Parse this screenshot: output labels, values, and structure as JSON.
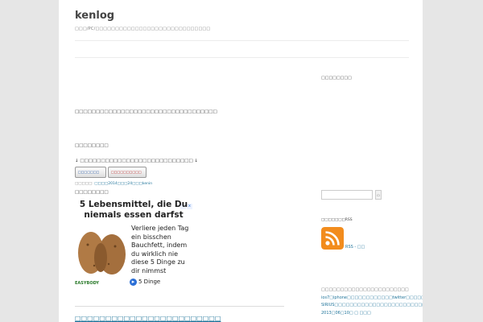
{
  "site": {
    "title": "kenlog",
    "description": "□□□/PC/□□□□□□□□□□□□□□□□□□□□□□□□□□□□□"
  },
  "post": {
    "para1": "□□□□□□□□□□□□□□□□□□□□□□□□□□□□□□□□□□",
    "para2": "□□□□□□□□",
    "ranking_note": "↓ □□□□□□□□□□□□□□□□□□□□□□□□□□□ ↓",
    "banners": [
      "□□□□□□□",
      "□□□□□□□□□□"
    ],
    "meta_prefix": "□□□□□: ",
    "meta_date": "□□□□2014□□□24□",
    "meta_author": "□□kenin",
    "para3": "□□□□□□□□"
  },
  "ad": {
    "badge": [
      "i",
      "x"
    ],
    "headline": "5 Lebensmittel, die Du niemals essen darfst",
    "body": "Verliere jeden Tag ein bisschen Bauchfett, indem du wirklich nie diese 5 Dinge zu dir nimmst",
    "logo": "EASYBODY",
    "cta": "5 Dinge",
    "cta_icon": "▸"
  },
  "next_post": {
    "title": "□□□□□□□□□□□□□□□□□□□□□□□□"
  },
  "sidebar": {
    "heading": "□□□□□□□□",
    "search_placeholder": "",
    "search_button": "□",
    "rss_heading": "□□□□□□□RSS",
    "rss_link": "RSS - □□",
    "recent_heading": "□□□□□□□□□□□□□□□□□□□□□□□",
    "recent": [
      "ios7□iphone□□□□□□□□□□□□twitter□□□□□□□□□□",
      "SIRIUS□□□□□□□□□□□□□□□□□□□□□□□□□□□□",
      "2013□06□10□ □ □□□"
    ]
  },
  "colors": {
    "link": "#21759b",
    "rss": "#f28c1d"
  }
}
